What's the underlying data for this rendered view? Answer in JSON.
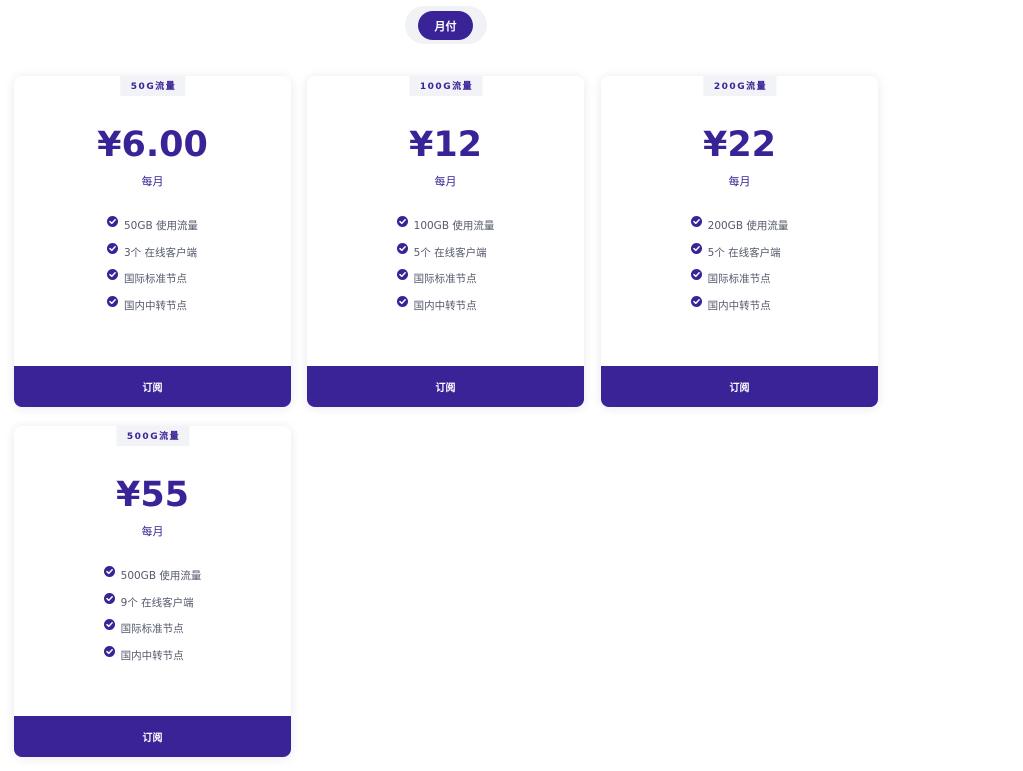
{
  "billing_toggle": {
    "active_label": "月付"
  },
  "plans": [
    {
      "badge": "50G流量",
      "price": "¥6.00",
      "period": "每月",
      "features": [
        "50GB 使用流量",
        "3个 在线客户端",
        "国际标准节点",
        "国内中转节点"
      ],
      "button_label": "订阅"
    },
    {
      "badge": "100G流量",
      "price": "¥12",
      "period": "每月",
      "features": [
        "100GB 使用流量",
        "5个 在线客户端",
        "国际标准节点",
        "国内中转节点"
      ],
      "button_label": "订阅"
    },
    {
      "badge": "200G流量",
      "price": "¥22",
      "period": "每月",
      "features": [
        "200GB 使用流量",
        "5个 在线客户端",
        "国际标准节点",
        "国内中转节点"
      ],
      "button_label": "订阅"
    },
    {
      "badge": "500G流量",
      "price": "¥55",
      "period": "每月",
      "features": [
        "500GB 使用流量",
        "9个 在线客户端",
        "国际标准节点",
        "国内中转节点"
      ],
      "button_label": "订阅"
    }
  ],
  "icons": {
    "feature": "check-circle-icon"
  },
  "colors": {
    "accent": "#3a2297",
    "badge_bg": "#f1f3f7",
    "toggle_bg": "#f1f2f6",
    "feature_text": "#555a6b"
  }
}
